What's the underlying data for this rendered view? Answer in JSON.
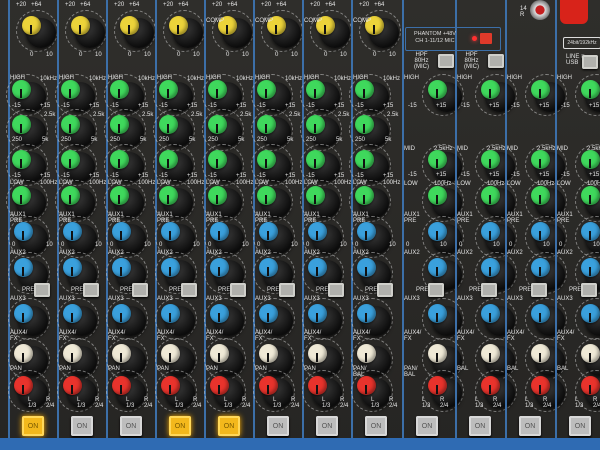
{
  "colors": {
    "eq": "#3fd85c",
    "aux": "#3aa0dc",
    "fx": "#efe9d6",
    "pan": "#e8332c",
    "gain": "#ecd33a",
    "on_lit": "#f3b81c",
    "panel": "#2b2a28",
    "divider": "#3c6fa8"
  },
  "top_panel": {
    "phantom_line1": "PHANTOM +48V",
    "phantom_line2": "CH 1-11/12 MIC",
    "hpf_label": "HPF\n80Hz\n(MIC)",
    "usb_label": "24bit/192kHz",
    "line_usb_label": "LINE ≡\nUSB",
    "jack_label": "14\nR",
    "gain_scale_min": "0",
    "gain_scale_max": "10",
    "gain_markers": "+20   +64"
  },
  "labels": {
    "comp": "COMP",
    "high": "HIGH",
    "high_freq": "10kHz",
    "mid": "MID",
    "mid_freq": "2.5kHz",
    "mid_sweep_low": "250",
    "mid_sweep_mid": "2.5k",
    "mid_sweep_high": "5k",
    "low": "LOW",
    "low_freq": "100Hz",
    "minus": "-15",
    "plus": "+15",
    "aux1": "AUX1\nPRE",
    "aux2": "AUX2",
    "pre": "PRE",
    "aux3": "AUX3",
    "aux4": "AUX4/\nFX",
    "aux_min": "0",
    "aux_max": "10",
    "pan_l": "L\n1/3",
    "pan_r": "R\n2/4",
    "on": "ON"
  },
  "channels": [
    {
      "type": "mono",
      "top": "",
      "pan": "PAN",
      "on_lit": true
    },
    {
      "type": "mono",
      "top": "",
      "pan": "PAN",
      "on_lit": false
    },
    {
      "type": "mono",
      "top": "",
      "pan": "PAN",
      "on_lit": false
    },
    {
      "type": "mono",
      "top": "",
      "pan": "PAN",
      "on_lit": true
    },
    {
      "type": "mono",
      "top": "COMP",
      "pan": "PAN",
      "on_lit": true
    },
    {
      "type": "mono",
      "top": "COMP",
      "pan": "PAN",
      "on_lit": false
    },
    {
      "type": "mono",
      "top": "COMP",
      "pan": "PAN",
      "on_lit": false
    },
    {
      "type": "mono",
      "top": "COMP",
      "pan": "PAN/\nBAL",
      "on_lit": false
    },
    {
      "type": "stereo",
      "top": "",
      "pan": "PAN/\nBAL",
      "on_lit": false
    },
    {
      "type": "stereo",
      "top": "",
      "pan": "BAL",
      "on_lit": false
    },
    {
      "type": "stereo",
      "top": "",
      "pan": "BAL",
      "on_lit": false
    },
    {
      "type": "stereo",
      "top": "",
      "pan": "BAL",
      "on_lit": false
    }
  ]
}
